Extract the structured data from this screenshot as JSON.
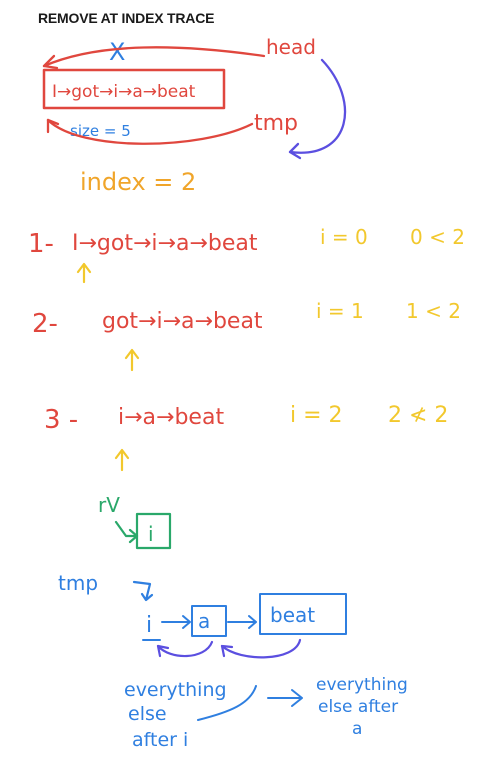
{
  "title": "REMOVE AT INDEX TRACE",
  "colors": {
    "red": "#e0473e",
    "purple": "#8e4fd8",
    "blue": "#2f7fe0",
    "orange": "#f0a52a",
    "yellow": "#f2c82d",
    "green": "#2aa86a",
    "indigo": "#5b4fe0"
  },
  "top": {
    "x_mark": "X",
    "list": "I→got→i→a→beat",
    "head": "head",
    "size": "size = 5",
    "tmp": "tmp"
  },
  "index_line": "index = 2",
  "steps": [
    {
      "num": "1-",
      "list": "I→got→i→a→beat",
      "i": "i = 0",
      "cond": "0 < 2"
    },
    {
      "num": "2-",
      "list": "got→i→a→beat",
      "i": "i = 1",
      "cond": "1 < 2"
    },
    {
      "num": "3 -",
      "list": "i→a→beat",
      "i": "i = 2",
      "cond": "2 ≮ 2"
    }
  ],
  "rv": {
    "label": "rV",
    "box": "i"
  },
  "bottom": {
    "tmp": "tmp",
    "n1": "i",
    "n2": "a",
    "n3": "beat",
    "note_left": [
      "everything",
      "else",
      "after i"
    ],
    "note_right": [
      "everything",
      "else after",
      "a"
    ]
  }
}
